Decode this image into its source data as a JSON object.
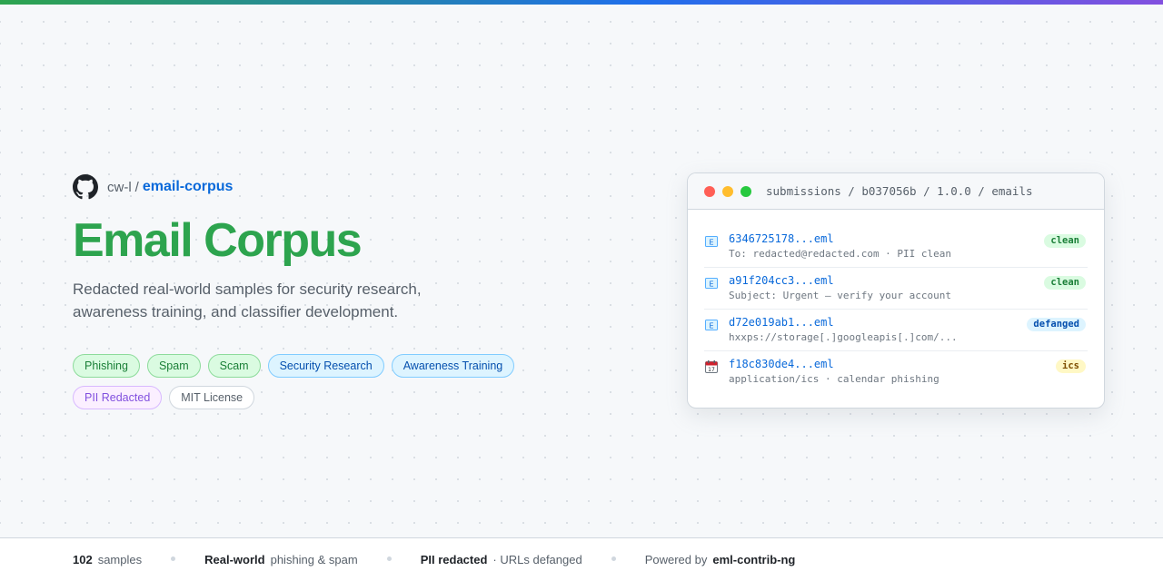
{
  "repo": {
    "owner": "cw-l",
    "separator": "/",
    "name": "email-corpus"
  },
  "hero": {
    "title": "Email Corpus",
    "subtitle": "Redacted real-world samples for security research, awareness training, and classifier development."
  },
  "tags": [
    {
      "label": "Phishing",
      "color": "green"
    },
    {
      "label": "Spam",
      "color": "green"
    },
    {
      "label": "Scam",
      "color": "green"
    },
    {
      "label": "Security Research",
      "color": "blue"
    },
    {
      "label": "Awareness Training",
      "color": "blue"
    },
    {
      "label": "PII Redacted",
      "color": "purple"
    },
    {
      "label": "MIT License",
      "color": "gray"
    }
  ],
  "window": {
    "path": "submissions / b037056b / 1.0.0 / emails",
    "files": [
      {
        "icon": "email-icon",
        "name": "6346725178...eml",
        "meta": "To: redacted@redacted.com · PII clean",
        "badge": "clean"
      },
      {
        "icon": "email-icon",
        "name": "a91f204cc3...eml",
        "meta": "Subject: Urgent — verify your account",
        "badge": "clean"
      },
      {
        "icon": "email-icon",
        "name": "d72e019ab1...eml",
        "meta": "hxxps://storage[.]googleapis[.]com/...",
        "badge": "defanged"
      },
      {
        "icon": "calendar-icon",
        "name": "f18c830de4...eml",
        "meta": "application/ics · calendar phishing",
        "badge": "ics"
      }
    ]
  },
  "footer": {
    "samples_count": "102",
    "samples_label": "samples",
    "realworld_strong": "Real-world",
    "realworld_label": "phishing & spam",
    "pii_strong": "PII redacted",
    "pii_label": "· URLs defanged",
    "powered_label": "Powered by",
    "powered_strong": "eml-contrib-ng"
  },
  "colors": {
    "accent_green": "#2da44e",
    "link_blue": "#0969da"
  }
}
